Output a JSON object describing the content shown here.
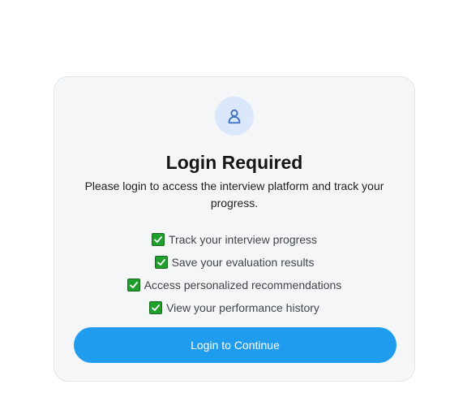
{
  "card": {
    "icon": "user-icon",
    "title": "Login Required",
    "subtitle": "Please login to access the interview platform and track your progress."
  },
  "features": [
    {
      "icon": "checkbox-checked-icon",
      "label": "Track your interview progress"
    },
    {
      "icon": "checkbox-checked-icon",
      "label": "Save your evaluation results"
    },
    {
      "icon": "checkbox-checked-icon",
      "label": "Access personalized recommendations"
    },
    {
      "icon": "checkbox-checked-icon",
      "label": "View your performance history"
    }
  ],
  "login_button": {
    "label": "Login to Continue"
  },
  "colors": {
    "accent": "#209cee",
    "check": "#1fa02c",
    "icon_bg": "#dbe8fb"
  }
}
